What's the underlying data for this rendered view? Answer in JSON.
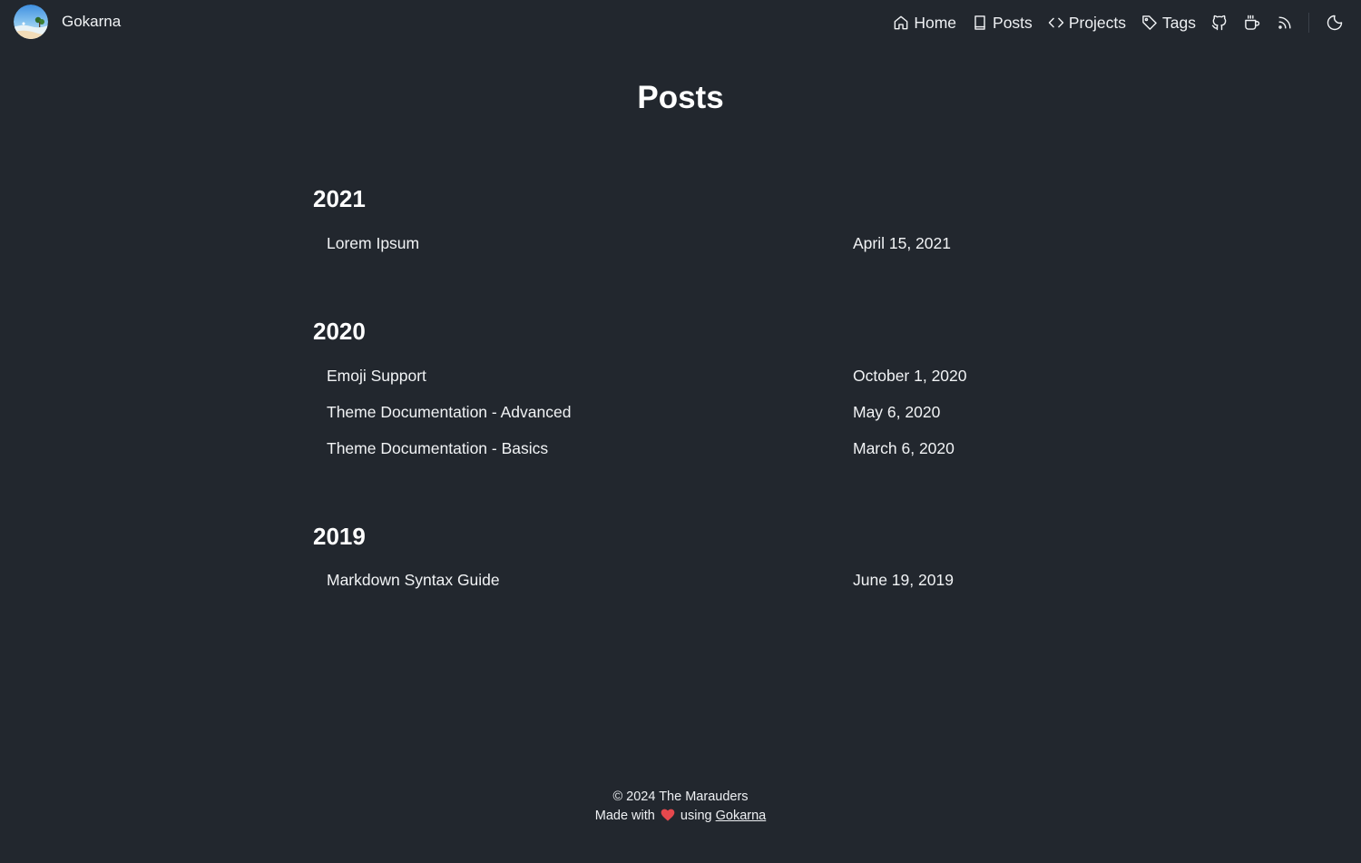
{
  "site": {
    "name": "Gokarna"
  },
  "nav": {
    "home_label": "Home",
    "posts_label": "Posts",
    "projects_label": "Projects",
    "tags_label": "Tags",
    "icons": [
      "home-icon",
      "book-icon",
      "code-icon",
      "tag-icon",
      "github-icon",
      "coffee-icon",
      "rss-icon",
      "moon-icon"
    ]
  },
  "main": {
    "title": "Posts",
    "groups": [
      {
        "year": "2021",
        "posts": [
          {
            "title": "Lorem Ipsum",
            "date": "April 15, 2021"
          }
        ]
      },
      {
        "year": "2020",
        "posts": [
          {
            "title": "Emoji Support",
            "date": "October 1, 2020"
          },
          {
            "title": "Theme Documentation - Advanced",
            "date": "May 6, 2020"
          },
          {
            "title": "Theme Documentation - Basics",
            "date": "March 6, 2020"
          }
        ]
      },
      {
        "year": "2019",
        "posts": [
          {
            "title": "Markdown Syntax Guide",
            "date": "June 19, 2019"
          }
        ]
      }
    ]
  },
  "footer": {
    "copyright": "© 2024 The Marauders",
    "made_with": "Made with",
    "using": "using",
    "link_label": "Gokarna"
  },
  "colors": {
    "background": "#22272e",
    "text": "#f1f3f5",
    "heart": "#e5484d"
  }
}
